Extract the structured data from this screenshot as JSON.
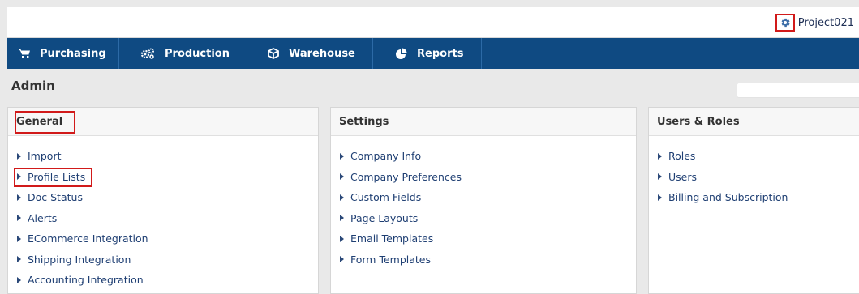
{
  "header": {
    "project_name": "Project021",
    "settings_icon": "gear-icon"
  },
  "nav": {
    "items": [
      {
        "label": "Purchasing",
        "icon": "cart-icon"
      },
      {
        "label": "Production",
        "icon": "gears-icon"
      },
      {
        "label": "Warehouse",
        "icon": "box-icon"
      },
      {
        "label": "Reports",
        "icon": "pie-chart-icon"
      }
    ]
  },
  "page": {
    "title": "Admin"
  },
  "panels": {
    "general": {
      "title": "General",
      "items": [
        "Import",
        "Profile Lists",
        "Doc Status",
        "Alerts",
        "ECommerce Integration",
        "Shipping Integration",
        "Accounting Integration"
      ]
    },
    "settings": {
      "title": "Settings",
      "items": [
        "Company Info",
        "Company Preferences",
        "Custom Fields",
        "Page Layouts",
        "Email Templates",
        "Form Templates"
      ]
    },
    "users": {
      "title": "Users & Roles",
      "items": [
        "Roles",
        "Users",
        "Billing and Subscription"
      ]
    }
  },
  "colors": {
    "nav_bg": "#0f4a82",
    "highlight": "#d11a1a",
    "link": "#1f3f73"
  }
}
